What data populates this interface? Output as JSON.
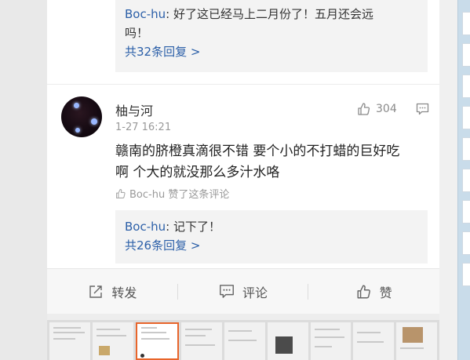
{
  "thread": {
    "top_reply": {
      "user": "Boc-hu",
      "text": ": 好了这已经马上二月份了！五月还会远",
      "text_cont": "吗！",
      "more": "共32条回复 >"
    },
    "comment": {
      "username": "柚与河",
      "timestamp": "1-27 16:21",
      "like_count": "304",
      "text_line1": "赣南的脐橙真滴很不错 要个小的不打蜡的巨好吃",
      "text_line2": "啊 个大的就没那么多汁水咯",
      "liked_by": "Boc-hu 赞了这条评论",
      "reply": {
        "user": "Boc-hu",
        "text": ": 记下了！",
        "more": "共26条回复 >"
      }
    }
  },
  "actions": {
    "forward": "转发",
    "comment": "评论",
    "like": "赞"
  },
  "icons": [
    "thumbs-up-icon",
    "comment-bubble-icon",
    "forward-icon"
  ],
  "colors": {
    "link": "#2b5fa8",
    "active_thumb_border": "#e8652b"
  }
}
